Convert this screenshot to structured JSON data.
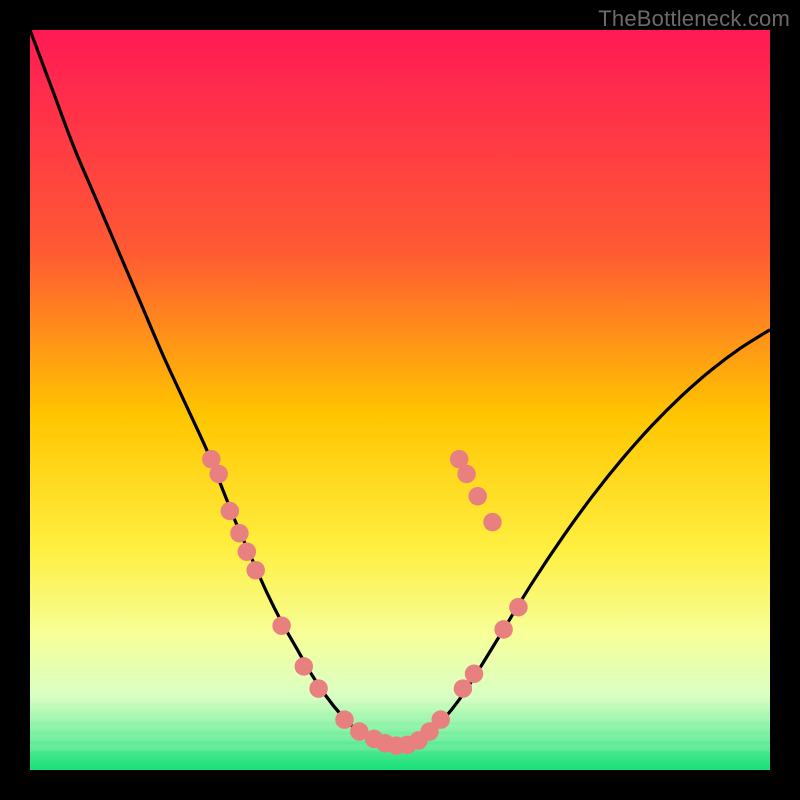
{
  "watermark": "TheBottleneck.com",
  "chart_data": {
    "type": "line",
    "title": "",
    "xlabel": "",
    "ylabel": "",
    "xlim": [
      0,
      100
    ],
    "ylim": [
      0,
      100
    ],
    "gradient_stops": [
      {
        "offset": 0,
        "color": "#ff1a55"
      },
      {
        "offset": 30,
        "color": "#ff5a33"
      },
      {
        "offset": 52,
        "color": "#ffc500"
      },
      {
        "offset": 70,
        "color": "#ffef40"
      },
      {
        "offset": 82,
        "color": "#f6ff9a"
      },
      {
        "offset": 90,
        "color": "#d8ffc0"
      },
      {
        "offset": 100,
        "color": "#18e07a"
      }
    ],
    "series": [
      {
        "name": "bottleneck-curve",
        "color": "#000000",
        "x": [
          0,
          3,
          6,
          9,
          12,
          15,
          18,
          21,
          24,
          26,
          28,
          30,
          32,
          34,
          36,
          38,
          40,
          42,
          44,
          46,
          48,
          50,
          52,
          54,
          56,
          58,
          60,
          64,
          68,
          72,
          76,
          80,
          84,
          88,
          92,
          96,
          100
        ],
        "y": [
          100,
          92,
          84,
          77,
          70,
          63,
          56,
          49.5,
          43,
          38,
          33,
          28.5,
          24,
          20,
          16.5,
          13,
          10,
          7.5,
          5.5,
          4,
          3,
          3,
          3.5,
          5,
          7,
          9.5,
          12.5,
          19,
          25.5,
          31.5,
          37,
          42,
          46.5,
          50.5,
          54,
          57,
          59.5
        ]
      }
    ],
    "markers": {
      "color": "#e98080",
      "radius_pct": 1.25,
      "points": [
        {
          "x": 24.5,
          "y": 42
        },
        {
          "x": 25.5,
          "y": 40
        },
        {
          "x": 27.0,
          "y": 35
        },
        {
          "x": 28.3,
          "y": 32
        },
        {
          "x": 29.3,
          "y": 29.5
        },
        {
          "x": 30.5,
          "y": 27
        },
        {
          "x": 34.0,
          "y": 19.5
        },
        {
          "x": 37.0,
          "y": 14
        },
        {
          "x": 39.0,
          "y": 11
        },
        {
          "x": 42.5,
          "y": 6.8
        },
        {
          "x": 44.5,
          "y": 5.2
        },
        {
          "x": 46.5,
          "y": 4.2
        },
        {
          "x": 48.0,
          "y": 3.6
        },
        {
          "x": 49.5,
          "y": 3.3
        },
        {
          "x": 51.0,
          "y": 3.4
        },
        {
          "x": 52.5,
          "y": 4.0
        },
        {
          "x": 54.0,
          "y": 5.2
        },
        {
          "x": 55.5,
          "y": 6.8
        },
        {
          "x": 58.5,
          "y": 11
        },
        {
          "x": 60.0,
          "y": 13
        },
        {
          "x": 64.0,
          "y": 19
        },
        {
          "x": 66.0,
          "y": 22
        },
        {
          "x": 58.0,
          "y": 42
        },
        {
          "x": 59.0,
          "y": 40
        },
        {
          "x": 60.5,
          "y": 37
        },
        {
          "x": 62.5,
          "y": 33.5
        }
      ]
    }
  }
}
